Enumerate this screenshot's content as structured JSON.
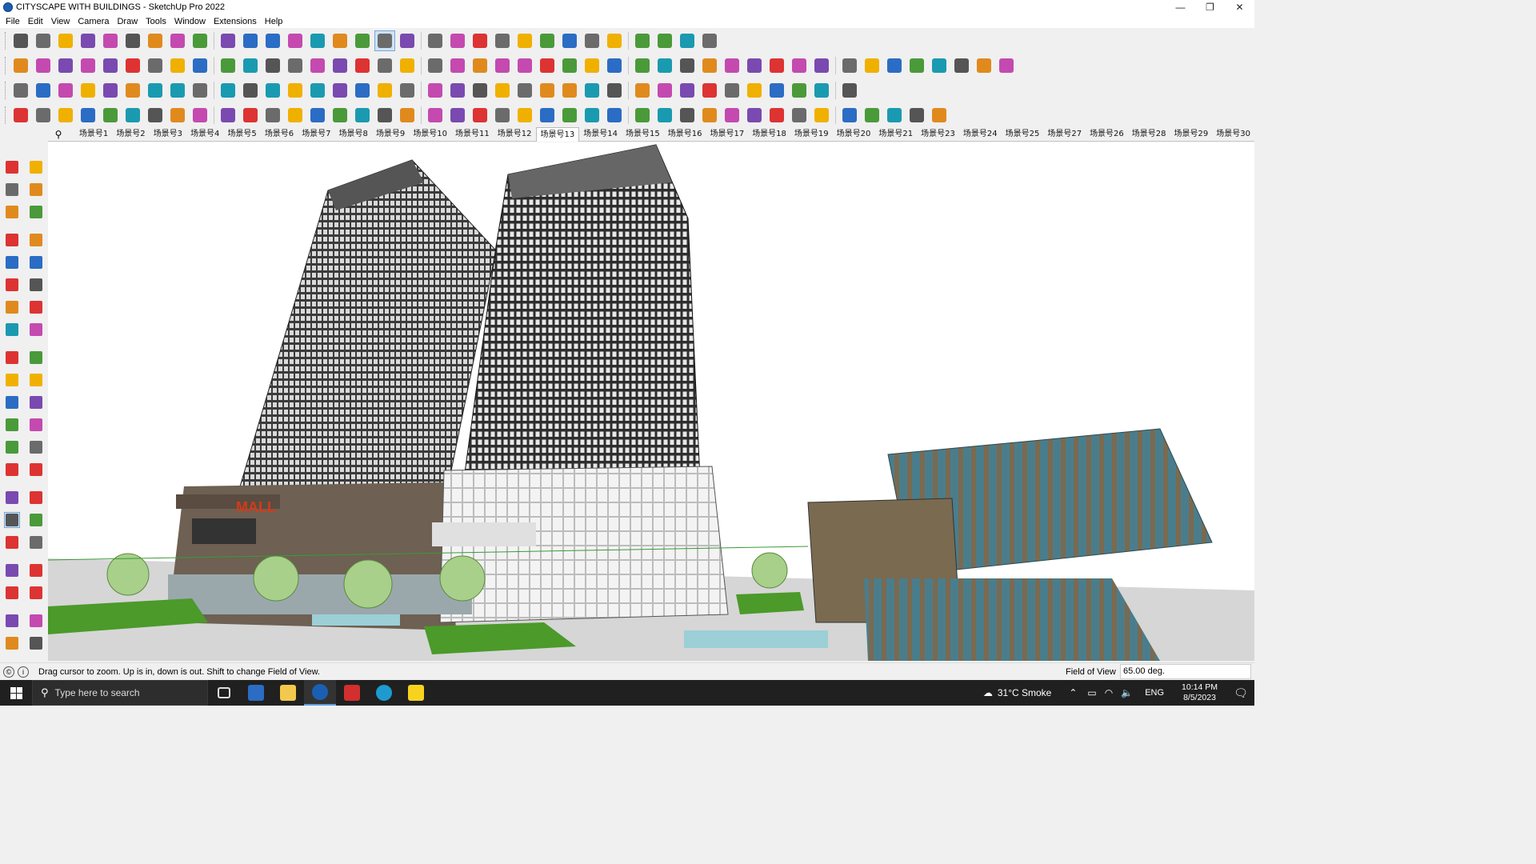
{
  "window": {
    "title": "CITYSCAPE WITH BUILDINGS - SketchUp Pro 2022",
    "minimize": "—",
    "restore": "❐",
    "close": "✕"
  },
  "menu": [
    "File",
    "Edit",
    "View",
    "Camera",
    "Draw",
    "Tools",
    "Window",
    "Extensions",
    "Help"
  ],
  "toolbars": {
    "row1": [
      "zoom-icon",
      "select-icon",
      "eraser-icon",
      "line-icon",
      "freehand-icon",
      "rectangle-icon",
      "push-pull-icon",
      "follow-me-icon",
      "move-icon",
      "rotate-icon",
      "scale-icon",
      "tape-measure-icon",
      "text-icon",
      "paint-bucket-icon",
      "orbit-icon",
      "pan-icon",
      "zoom-active-icon",
      "zoom-extents-icon",
      "style-icon",
      "section-plane-icon",
      "layers-icon",
      "shadow-icon",
      "camera-icon",
      "component-icon",
      "tag-icon",
      "flip-icon",
      "axes-icon",
      "measure-icon",
      "undo-icon",
      "redo-icon",
      "warehouse-icon"
    ],
    "row2": [
      "solid-1-icon",
      "solid-2-icon",
      "solid-3-icon",
      "extension-a-icon",
      "extension-b-icon",
      "extension-c-icon",
      "extension-d-icon",
      "extension-e-icon",
      "extension-f-icon",
      "extension-g-icon",
      "extension-h-icon",
      "extension-i-icon",
      "arc-icon",
      "extension-j-icon",
      "extension-k-icon",
      "extension-l-icon",
      "extension-m-icon",
      "extension-n-icon",
      "house-icon",
      "house-outline-icon",
      "house-2-icon",
      "house-3-icon",
      "font-icon",
      "tooltip-icon",
      "pencil-icon",
      "curve-1-icon",
      "curve-2-icon",
      "curve-3-icon",
      "curve-4-icon",
      "curve-5-icon",
      "curve-6-icon",
      "curve-7-icon",
      "curve-8-icon",
      "curve-9-icon",
      "curve-10-icon",
      "line-red-icon",
      "eraser-pink-icon",
      "extension-o-icon",
      "extension-p-icon",
      "extension-q-icon",
      "extension-r-icon",
      "extension-s-icon",
      "extension-t-icon",
      "extension-u-icon"
    ],
    "row3": [
      "cube-blue-icon",
      "diamond-blue-icon",
      "diamond-yellow-icon",
      "diamond-green-icon",
      "diamond-red-icon",
      "diamond-gray-icon",
      "rotate-orange-icon",
      "square-red-icon",
      "table-icon",
      "page-icon",
      "wave-icon",
      "arc-gray-icon",
      "spline-icon",
      "cross-orange-icon",
      "cross-green-icon",
      "cross-blue-icon",
      "cone-icon",
      "triangle-icon",
      "circle-icon",
      "spiral-icon",
      "ring-icon",
      "move-blue-icon",
      "bag-icon",
      "undo-red-icon",
      "swirl-icon",
      "tool-a-icon",
      "tool-b-icon",
      "tool-c-icon",
      "tool-d-icon",
      "tool-e-icon",
      "tool-f-icon",
      "tool-g-icon",
      "tool-h-icon",
      "tool-i-icon",
      "tool-j-icon",
      "tool-k-icon",
      "tool-l-icon"
    ],
    "row4": [
      "draw-a-icon",
      "draw-b-icon",
      "draw-c-icon",
      "draw-d-icon",
      "draw-e-icon",
      "draw-f-icon",
      "draw-g-icon",
      "draw-h-icon",
      "draw-i-icon",
      "draw-j-icon",
      "draw-k-icon",
      "draw-l-icon",
      "draw-m-icon",
      "draw-n-icon",
      "draw-o-icon",
      "draw-p-icon",
      "draw-q-icon",
      "draw-r-icon",
      "draw-s-icon",
      "draw-t-icon",
      "draw-u-icon",
      "draw-v-icon",
      "draw-w-icon",
      "draw-x-icon",
      "draw-y-icon",
      "draw-z-icon",
      "draw-aa-icon",
      "draw-ab-icon",
      "draw-ac-icon",
      "draw-ad-icon",
      "draw-ae-icon",
      "draw-af-icon",
      "draw-ag-icon",
      "draw-ah-icon",
      "draw-ai-icon",
      "draw-aj-icon",
      "draw-ak-icon",
      "draw-al-icon",
      "draw-am-icon",
      "draw-an-icon",
      "draw-ao-icon"
    ]
  },
  "scenes": [
    "场景号1",
    "场景号2",
    "场景号3",
    "场景号4",
    "场景号5",
    "场景号6",
    "场景号7",
    "场景号8",
    "场景号9",
    "场景号10",
    "场景号11",
    "场景号12",
    "场景号13",
    "场景号14",
    "场景号15",
    "场景号16",
    "场景号17",
    "场景号18",
    "场景号19",
    "场景号20",
    "场景号21",
    "场景号23",
    "场景号24",
    "场景号25",
    "场景号27",
    "场景号26",
    "场景号28",
    "场景号29",
    "场景号30"
  ],
  "active_scene": "场景号13",
  "left_tools": [
    "select-icon",
    "orbit-icon",
    "paint-icon",
    "eraser-icon",
    "component-icon",
    "tag-icon",
    "line-icon",
    "freehand-icon",
    "rectangle-icon",
    "rotated-rect-icon",
    "circle-icon",
    "polygon-icon",
    "arc-icon",
    "arc-2-icon",
    "pie-icon",
    "arc-3-icon",
    "move-icon",
    "push-pull-icon",
    "rotate-icon",
    "follow-me-icon",
    "scale-icon",
    "offset-icon",
    "tape-icon",
    "dimension-icon",
    "protractor-icon",
    "text-icon",
    "axes-icon",
    "3d-text-icon",
    "orbit-2-icon",
    "pan-icon",
    "zoom-icon",
    "zoom-window-icon",
    "zoom-extents-icon",
    "previous-icon",
    "position-camera-icon",
    "look-around-icon",
    "walk-icon",
    "section-icon",
    "style-1-icon",
    "style-2-icon",
    "style-3-icon",
    "style-4-icon"
  ],
  "viewport": {
    "mall_sign": "MALL"
  },
  "status": {
    "message": "Drag cursor to zoom.  Up is in, down is out. Shift to change Field of View.",
    "measure_label": "Field of View",
    "measure_value": "65.00 deg."
  },
  "taskbar": {
    "search_placeholder": "Type here to search",
    "weather": "31°C  Smoke",
    "lang": "ENG",
    "time": "10:14 PM",
    "date": "8/5/2023"
  },
  "colors": {
    "tower": "#3a3a3a",
    "facade_glass": "#4a7d8c",
    "facade_wood": "#8c7a5c",
    "grass": "#4b9a2a",
    "sign_red": "#d43a1a"
  }
}
